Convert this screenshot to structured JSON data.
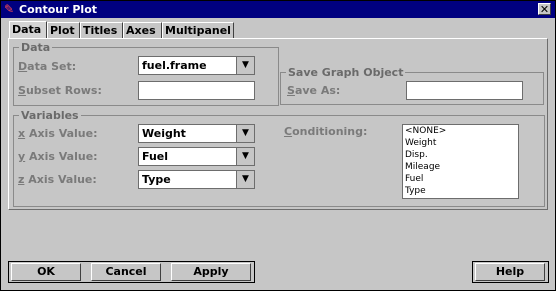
{
  "window": {
    "title": "Contour Plot",
    "close_glyph": "✕"
  },
  "tabs": [
    {
      "label": "Data"
    },
    {
      "label": "Plot"
    },
    {
      "label": "Titles"
    },
    {
      "label": "Axes"
    },
    {
      "label": "Multipanel"
    }
  ],
  "data_group": {
    "title": "Data",
    "data_set": {
      "label_first": "D",
      "label_rest": "ata Set:",
      "value": "fuel.frame"
    },
    "subset_rows": {
      "label_first": "S",
      "label_rest": "ubset Rows:",
      "value": ""
    }
  },
  "save_group": {
    "title": "Save Graph Object",
    "save_as": {
      "label_first": "S",
      "label_rest": "ave As:",
      "value": ""
    }
  },
  "variables_group": {
    "title": "Variables",
    "x_axis": {
      "label_first": "x",
      "label_rest": " Axis Value:",
      "value": "Weight"
    },
    "y_axis": {
      "label_first": "y",
      "label_rest": " Axis Value:",
      "value": "Fuel"
    },
    "z_axis": {
      "label_first": "z",
      "label_rest": " Axis Value:",
      "value": "Type"
    },
    "conditioning": {
      "label_first": "C",
      "label_rest": "onditioning:",
      "options": [
        "<NONE>",
        "Weight",
        "Disp.",
        "Mileage",
        "Fuel",
        "Type"
      ]
    }
  },
  "buttons": {
    "ok": "OK",
    "cancel": "Cancel",
    "apply": "Apply",
    "help": "Help"
  }
}
